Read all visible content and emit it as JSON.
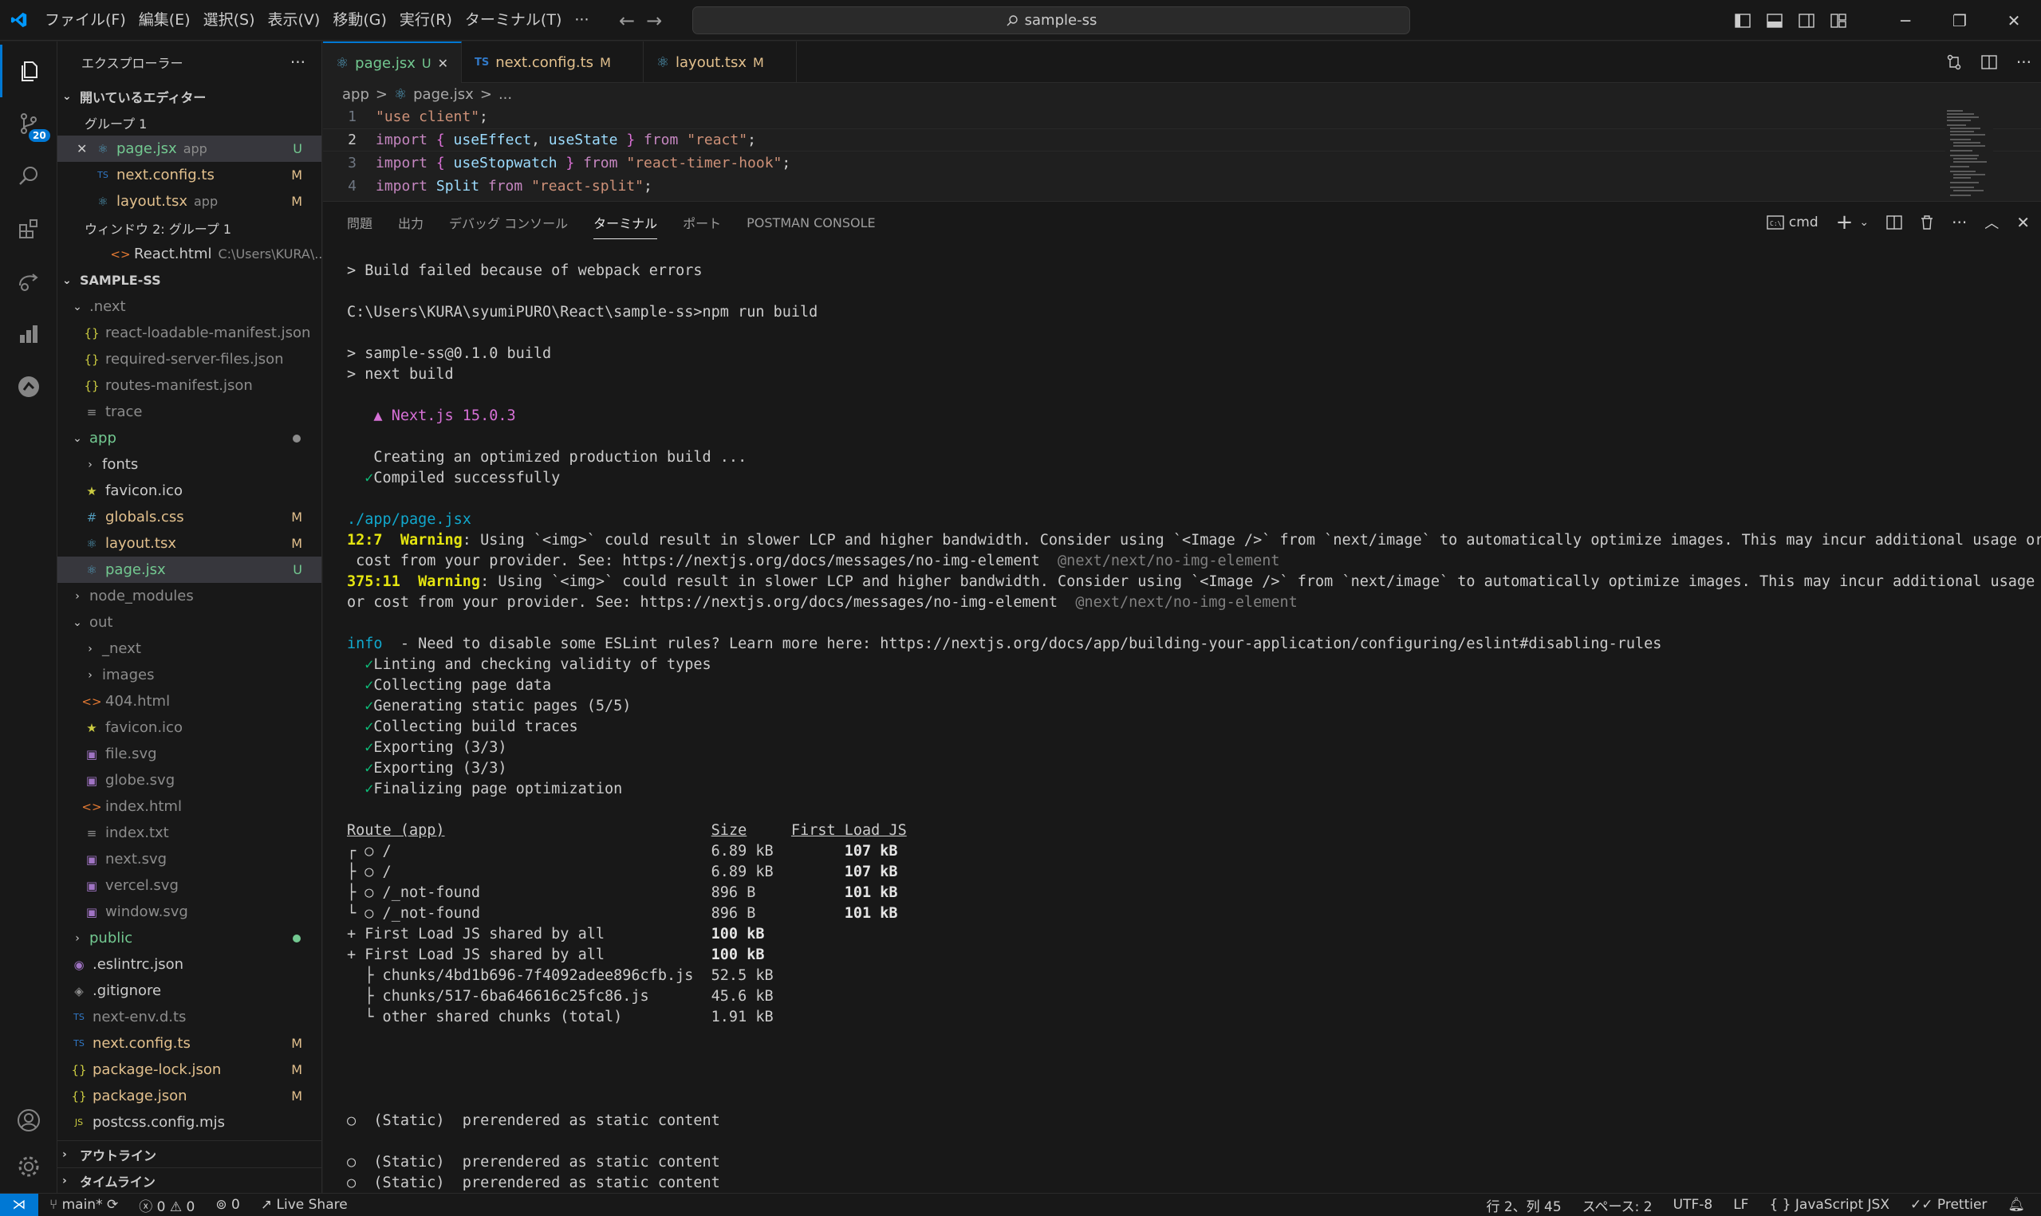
{
  "titlebar": {
    "menus": [
      "ファイル(F)",
      "編集(E)",
      "選択(S)",
      "表示(V)",
      "移動(G)",
      "実行(R)",
      "ターミナル(T)",
      "···"
    ],
    "search_text": "sample-ss",
    "window_controls": [
      "─",
      "❐",
      "✕"
    ]
  },
  "activity_bar": {
    "source_control_badge": "20",
    "items": [
      "explorer-icon",
      "source-control-icon",
      "search-icon",
      "extensions-icon",
      "remote-explorer-icon",
      "chart-icon",
      "gitlens-icon",
      "account-icon",
      "settings-gear-icon"
    ]
  },
  "sidebar": {
    "title": "エクスプローラー",
    "more": "···",
    "open_editors_label": "開いているエディター",
    "group1_label": "グループ 1",
    "open_editors": [
      {
        "icon": "⚛",
        "name": "page.jsx",
        "hint": "app",
        "badge": "U"
      },
      {
        "icon": "TS",
        "name": "next.config.ts",
        "hint": "",
        "badge": "M"
      },
      {
        "icon": "⚛",
        "name": "layout.tsx",
        "hint": "app",
        "badge": "M"
      }
    ],
    "group2_label": "ウィンドウ 2: グループ 1",
    "group2_file": {
      "icon": "<>",
      "name": "React.html",
      "hint": "C:\\Users\\KURA\\..."
    },
    "project_label": "SAMPLE-SS",
    "tree": [
      {
        "indent": 1,
        "chev": "⌄",
        "name": ".next",
        "color": "ignored"
      },
      {
        "indent": 2,
        "icon": "{}",
        "name": "react-loadable-manifest.json",
        "color": "ignored"
      },
      {
        "indent": 2,
        "icon": "{}",
        "name": "required-server-files.json",
        "color": "ignored"
      },
      {
        "indent": 2,
        "icon": "{}",
        "name": "routes-manifest.json",
        "color": "ignored"
      },
      {
        "indent": 2,
        "icon": "≡",
        "name": "trace",
        "color": "ignored"
      },
      {
        "indent": 1,
        "chev": "⌄",
        "name": "app",
        "color": "untracked",
        "dot": "#8c8c8c"
      },
      {
        "indent": 2,
        "chev": "›",
        "name": "fonts",
        "color": "normal"
      },
      {
        "indent": 2,
        "icon": "★",
        "name": "favicon.ico",
        "color": "normal"
      },
      {
        "indent": 2,
        "icon": "#",
        "name": "globals.css",
        "color": "mod",
        "badge": "M"
      },
      {
        "indent": 2,
        "icon": "⚛",
        "name": "layout.tsx",
        "color": "mod",
        "badge": "M"
      },
      {
        "indent": 2,
        "icon": "⚛",
        "name": "page.jsx",
        "color": "untracked",
        "badge": "U",
        "selected": true
      },
      {
        "indent": 1,
        "chev": "›",
        "name": "node_modules",
        "color": "ignored"
      },
      {
        "indent": 1,
        "chev": "⌄",
        "name": "out",
        "color": "ignored"
      },
      {
        "indent": 2,
        "chev": "›",
        "name": "_next",
        "color": "ignored"
      },
      {
        "indent": 2,
        "chev": "›",
        "name": "images",
        "color": "ignored"
      },
      {
        "indent": 2,
        "icon": "<>",
        "name": "404.html",
        "color": "ignored"
      },
      {
        "indent": 2,
        "icon": "★",
        "name": "favicon.ico",
        "color": "ignored"
      },
      {
        "indent": 2,
        "icon": "▣",
        "name": "file.svg",
        "color": "ignored"
      },
      {
        "indent": 2,
        "icon": "▣",
        "name": "globe.svg",
        "color": "ignored"
      },
      {
        "indent": 2,
        "icon": "<>",
        "name": "index.html",
        "color": "ignored"
      },
      {
        "indent": 2,
        "icon": "≡",
        "name": "index.txt",
        "color": "ignored"
      },
      {
        "indent": 2,
        "icon": "▣",
        "name": "next.svg",
        "color": "ignored"
      },
      {
        "indent": 2,
        "icon": "▣",
        "name": "vercel.svg",
        "color": "ignored"
      },
      {
        "indent": 2,
        "icon": "▣",
        "name": "window.svg",
        "color": "ignored"
      },
      {
        "indent": 1,
        "chev": "›",
        "name": "public",
        "color": "untracked",
        "dot": "#73c991"
      },
      {
        "indent": 1,
        "icon": "◉",
        "name": ".eslintrc.json",
        "color": "normal"
      },
      {
        "indent": 1,
        "icon": "◈",
        "name": ".gitignore",
        "color": "normal"
      },
      {
        "indent": 1,
        "icon": "TS",
        "name": "next-env.d.ts",
        "color": "ignored"
      },
      {
        "indent": 1,
        "icon": "TS",
        "name": "next.config.ts",
        "color": "mod",
        "badge": "M"
      },
      {
        "indent": 1,
        "icon": "{}",
        "name": "package-lock.json",
        "color": "mod",
        "badge": "M"
      },
      {
        "indent": 1,
        "icon": "{}",
        "name": "package.json",
        "color": "mod",
        "badge": "M"
      },
      {
        "indent": 1,
        "icon": "JS",
        "name": "postcss.config.mjs",
        "color": "normal"
      }
    ],
    "outline_label": "アウトライン",
    "timeline_label": "タイムライン"
  },
  "editor": {
    "tabs": [
      {
        "icon": "⚛",
        "name": "page.jsx",
        "status": "U",
        "active": true
      },
      {
        "icon": "TS",
        "name": "next.config.ts",
        "status": "M",
        "active": false
      },
      {
        "icon": "⚛",
        "name": "layout.tsx",
        "status": "M",
        "active": false
      }
    ],
    "breadcrumb": [
      "app",
      ">",
      "page.jsx",
      ">",
      "..."
    ],
    "lines": [
      {
        "n": "1",
        "html_parts": [
          {
            "t": "\"use client\"",
            "c": "str"
          },
          {
            "t": ";",
            "c": "white"
          }
        ]
      },
      {
        "n": "2",
        "html_parts": [
          {
            "t": "import ",
            "c": "imp"
          },
          {
            "t": "{ ",
            "c": "brace"
          },
          {
            "t": "useEffect",
            "c": "id"
          },
          {
            "t": ", ",
            "c": "white"
          },
          {
            "t": "useState",
            "c": "id"
          },
          {
            "t": " }",
            "c": "brace"
          },
          {
            "t": " from ",
            "c": "imp"
          },
          {
            "t": "\"react\"",
            "c": "str"
          },
          {
            "t": ";",
            "c": "white"
          }
        ]
      },
      {
        "n": "3",
        "html_parts": [
          {
            "t": "import ",
            "c": "imp"
          },
          {
            "t": "{ ",
            "c": "brace"
          },
          {
            "t": "useStopwatch",
            "c": "id"
          },
          {
            "t": " }",
            "c": "brace"
          },
          {
            "t": " from ",
            "c": "imp"
          },
          {
            "t": "\"react-timer-hook\"",
            "c": "str"
          },
          {
            "t": ";",
            "c": "white"
          }
        ]
      },
      {
        "n": "4",
        "html_parts": [
          {
            "t": "import ",
            "c": "imp"
          },
          {
            "t": "Split",
            "c": "id"
          },
          {
            "t": " from ",
            "c": "imp"
          },
          {
            "t": "\"react-split\"",
            "c": "str"
          },
          {
            "t": ";",
            "c": "white"
          }
        ]
      }
    ],
    "current_line": "2"
  },
  "panel": {
    "tabs": [
      "問題",
      "出力",
      "デバッグ コンソール",
      "ターミナル",
      "ポート",
      "POSTMAN CONSOLE"
    ],
    "active_tab": "ターミナル",
    "shell": "cmd",
    "terminal_lines": [
      [
        {
          "t": "> Build failed because of webpack errors"
        }
      ],
      [
        {
          "t": ""
        }
      ],
      [
        {
          "t": "C:\\Users\\KURA\\syumiPURO\\React\\sample-ss>npm run build"
        }
      ],
      [
        {
          "t": ""
        }
      ],
      [
        {
          "t": "> sample-ss@0.1.0 build"
        }
      ],
      [
        {
          "t": "> next build"
        }
      ],
      [
        {
          "t": ""
        }
      ],
      [
        {
          "t": "   ▲ Next.js 15.0.3",
          "c": "magenta"
        }
      ],
      [
        {
          "t": ""
        }
      ],
      [
        {
          "t": "   Creating an optimized production build ..."
        }
      ],
      [
        {
          "t": "  ✓",
          "c": "green"
        },
        {
          "t": "Compiled successfully"
        }
      ],
      [
        {
          "t": ""
        }
      ],
      [
        {
          "t": "./app/page.jsx",
          "c": "cyan"
        }
      ],
      [
        {
          "t": "12:7  ",
          "c": "yellow"
        },
        {
          "t": "Warning",
          "c": "yellow"
        },
        {
          "t": ": Using `<img>` could result in slower LCP and higher bandwidth. Consider using `<Image />` from `next/image` to automatically optimize images. This may incur additional usage or"
        }
      ],
      [
        {
          "t": " cost from your provider. See: https://nextjs.org/docs/messages/no-img-element  "
        },
        {
          "t": "@next/next/no-img-element",
          "c": "gray"
        }
      ],
      [
        {
          "t": "375:11  ",
          "c": "yellow"
        },
        {
          "t": "Warning",
          "c": "yellow"
        },
        {
          "t": ": Using `<img>` could result in slower LCP and higher bandwidth. Consider using `<Image />` from `next/image` to automatically optimize images. This may incur additional usage"
        }
      ],
      [
        {
          "t": "or cost from your provider. See: https://nextjs.org/docs/messages/no-img-element  "
        },
        {
          "t": "@next/next/no-img-element",
          "c": "gray"
        }
      ],
      [
        {
          "t": ""
        }
      ],
      [
        {
          "t": "info",
          "c": "cyan"
        },
        {
          "t": "  - Need to disable some ESLint rules? Learn more here: https://nextjs.org/docs/app/building-your-application/configuring/eslint#disabling-rules"
        }
      ],
      [
        {
          "t": "  ✓",
          "c": "green"
        },
        {
          "t": "Linting and checking validity of types"
        }
      ],
      [
        {
          "t": "  ✓",
          "c": "green"
        },
        {
          "t": "Collecting page data"
        }
      ],
      [
        {
          "t": "  ✓",
          "c": "green"
        },
        {
          "t": "Generating static pages (5/5)"
        }
      ],
      [
        {
          "t": "  ✓",
          "c": "green"
        },
        {
          "t": "Collecting build traces"
        }
      ],
      [
        {
          "t": "  ✓",
          "c": "green"
        },
        {
          "t": "Exporting (3/3)"
        }
      ],
      [
        {
          "t": "  ✓",
          "c": "green"
        },
        {
          "t": "Exporting (3/3)"
        }
      ],
      [
        {
          "t": "  ✓",
          "c": "green"
        },
        {
          "t": "Finalizing page optimization"
        }
      ],
      [
        {
          "t": ""
        }
      ],
      [
        {
          "t": "Route (app)",
          "c": "under"
        },
        {
          "t": "                              "
        },
        {
          "t": "Size",
          "c": "under"
        },
        {
          "t": "     "
        },
        {
          "t": "First Load JS",
          "c": "under"
        }
      ],
      [
        {
          "t": "┌ ○ /                                    6.89 kB        "
        },
        {
          "t": "107 kB",
          "c": "bold"
        }
      ],
      [
        {
          "t": "├ ○ /                                    6.89 kB        "
        },
        {
          "t": "107 kB",
          "c": "bold"
        }
      ],
      [
        {
          "t": "├ ○ /_not-found                          896 B          "
        },
        {
          "t": "101 kB",
          "c": "bold"
        }
      ],
      [
        {
          "t": "└ ○ /_not-found                          896 B          "
        },
        {
          "t": "101 kB",
          "c": "bold"
        }
      ],
      [
        {
          "t": "+ First Load JS shared by all            "
        },
        {
          "t": "100 kB",
          "c": "bold"
        }
      ],
      [
        {
          "t": "+ First Load JS shared by all            "
        },
        {
          "t": "100 kB",
          "c": "bold"
        }
      ],
      [
        {
          "t": "  ├ chunks/4bd1b696-7f4092adee896cfb.js  52.5 kB"
        }
      ],
      [
        {
          "t": "  ├ chunks/517-6ba646616c25fc86.js       45.6 kB"
        }
      ],
      [
        {
          "t": "  └ other shared chunks (total)          1.91 kB"
        }
      ],
      [
        {
          "t": ""
        }
      ],
      [
        {
          "t": ""
        }
      ],
      [
        {
          "t": ""
        }
      ],
      [
        {
          "t": ""
        }
      ],
      [
        {
          "t": "○  (Static)  prerendered as static content"
        }
      ],
      [
        {
          "t": ""
        }
      ],
      [
        {
          "t": "○  (Static)  prerendered as static content"
        }
      ],
      [
        {
          "t": "○  (Static)  prerendered as static content"
        }
      ]
    ]
  },
  "statusbar": {
    "branch": "main*",
    "errors": "0",
    "warnings": "0",
    "ports": "0",
    "live_share": "Live Share",
    "position": "行 2、列 45",
    "spaces": "スペース: 2",
    "encoding": "UTF-8",
    "eol": "LF",
    "language": "JavaScript JSX",
    "formatter": "Prettier"
  },
  "colors": {
    "accent": "#0078d4",
    "modified": "#e2c08d",
    "untracked": "#73c991"
  }
}
